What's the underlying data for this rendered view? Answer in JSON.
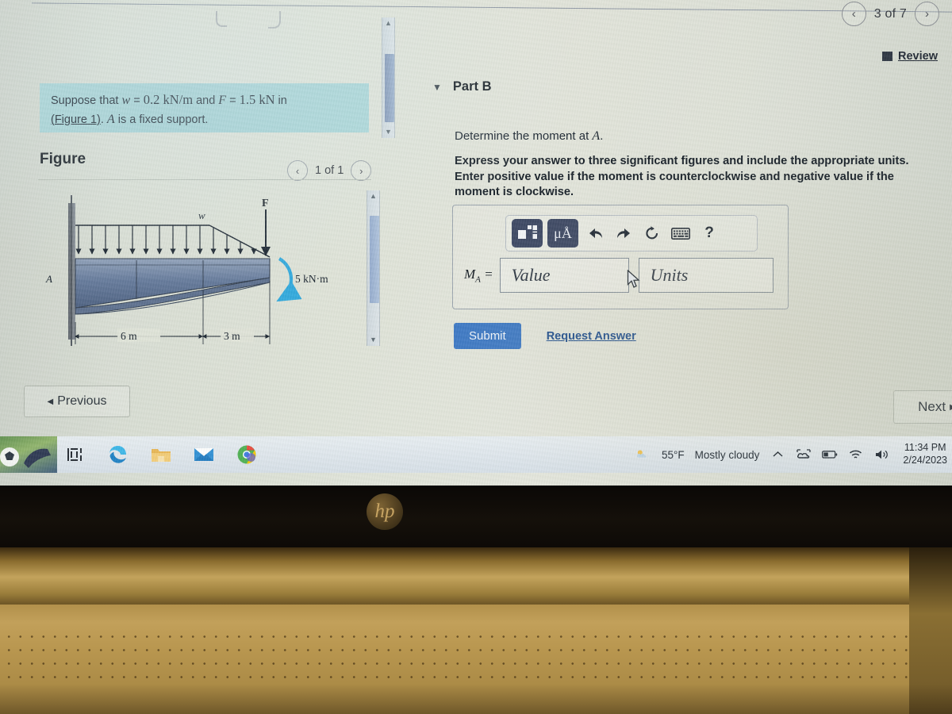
{
  "header": {
    "prev_icon": "chevron-left-icon",
    "next_icon": "chevron-right-icon",
    "problem_count": "3 of 7",
    "review_label": "Review"
  },
  "left": {
    "prompt_line1_a": "Suppose that ",
    "prompt_w": "w",
    "prompt_eq1": " = ",
    "prompt_w_value": "0.2 kN/m",
    "prompt_and": " and ",
    "prompt_F": "F",
    "prompt_eq2": " = ",
    "prompt_F_value": "1.5 kN",
    "prompt_in": " in",
    "figure_ref": "(Figure 1)",
    "prompt_line2_b": ". ",
    "prompt_A": "A",
    "prompt_line2_c": " is a fixed support.",
    "figure_title": "Figure",
    "figure_pager_count": "1 of 1",
    "figure_prev_icon": "chevron-left-icon",
    "figure_next_icon": "chevron-right-icon"
  },
  "diagram": {
    "support_label": "A",
    "load_label": "w",
    "force_label": "F",
    "moment_label": "5 kN·m",
    "dim_left": "6 m",
    "dim_right": "3 m",
    "beam_color": "#6b7f9c",
    "moment_arrow_color": "#2fa8dd"
  },
  "right": {
    "part_caret_icon": "caret-down-icon",
    "part_title": "Part B",
    "question": "Determine the moment at A.",
    "question_A": "A",
    "instructions": "Express your answer to three significant figures and include the appropriate units. Enter positive value if the moment is counterclockwise and negative value if the moment is clockwise.",
    "toolbar": {
      "template_icon": "math-template-icon",
      "units_label": "μÅ",
      "undo_icon": "undo-arrow-icon",
      "redo_icon": "redo-arrow-icon",
      "reset_icon": "reset-circular-arrow-icon",
      "keyboard_icon": "keyboard-icon",
      "help_label": "?"
    },
    "answer_label": "M",
    "answer_label_sub": "A",
    "answer_equals": "=",
    "value_placeholder": "Value",
    "units_placeholder": "Units",
    "value_current": "",
    "units_current": "",
    "submit_label": "Submit",
    "request_answer_label": "Request Answer"
  },
  "footer": {
    "previous_label": "Previous",
    "previous_icon": "triangle-left-icon",
    "next_label": "Next",
    "next_icon": "triangle-right-icon"
  },
  "taskbar": {
    "items": [
      {
        "name": "task-view-icon",
        "label": "Task View"
      },
      {
        "name": "edge-icon",
        "label": "Microsoft Edge"
      },
      {
        "name": "file-explorer-icon",
        "label": "File Explorer"
      },
      {
        "name": "mail-icon",
        "label": "Mail"
      },
      {
        "name": "chrome-icon",
        "label": "Google Chrome"
      }
    ],
    "weather_temp": "55°F",
    "weather_desc": "Mostly cloudy",
    "weather_icon": "partly-cloudy-icon",
    "chevron_icon": "chevron-up-icon",
    "onedrive_icon": "onedrive-icon",
    "battery_icon": "battery-icon",
    "wifi_icon": "wifi-icon",
    "volume_icon": "volume-icon",
    "time": "11:34 PM",
    "date": "2/24/2023"
  },
  "laptop": {
    "brand": "hp"
  }
}
